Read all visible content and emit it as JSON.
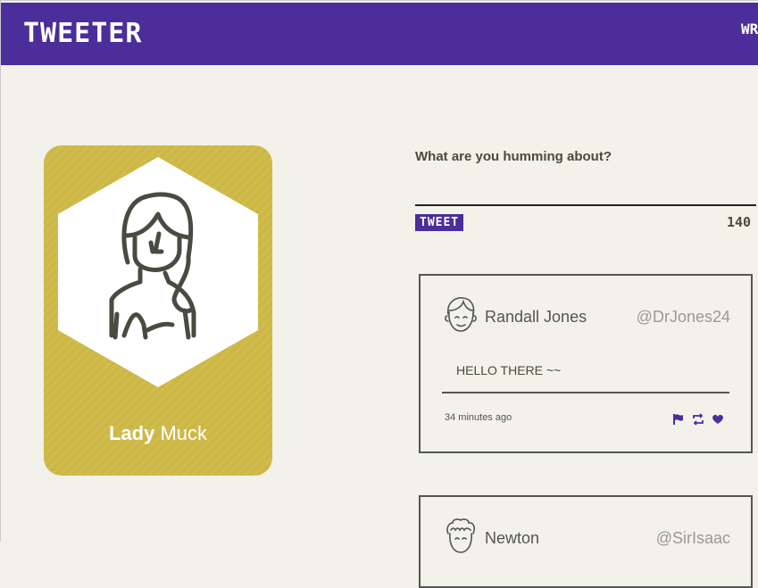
{
  "header": {
    "logo": "TWEETER",
    "nav_link": "WR"
  },
  "profile": {
    "first_name": "Lady",
    "last_name": "Muck",
    "card_color": "#cdb846"
  },
  "compose": {
    "prompt": "What are you humming about?",
    "input_value": "",
    "tweet_button": "TWEET",
    "char_count": "140"
  },
  "tweets": [
    {
      "name": "Randall Jones",
      "handle": "@DrJones24",
      "body": "HELLO THERE ~~",
      "time": "34 minutes ago",
      "actions": [
        "flag-icon",
        "retweet-icon",
        "heart-icon"
      ]
    },
    {
      "name": "Newton",
      "handle": "@SirIsaac"
    }
  ],
  "colors": {
    "brand": "#4b2e9a",
    "background": "#f2f1ea",
    "accent": "#cdb846"
  }
}
